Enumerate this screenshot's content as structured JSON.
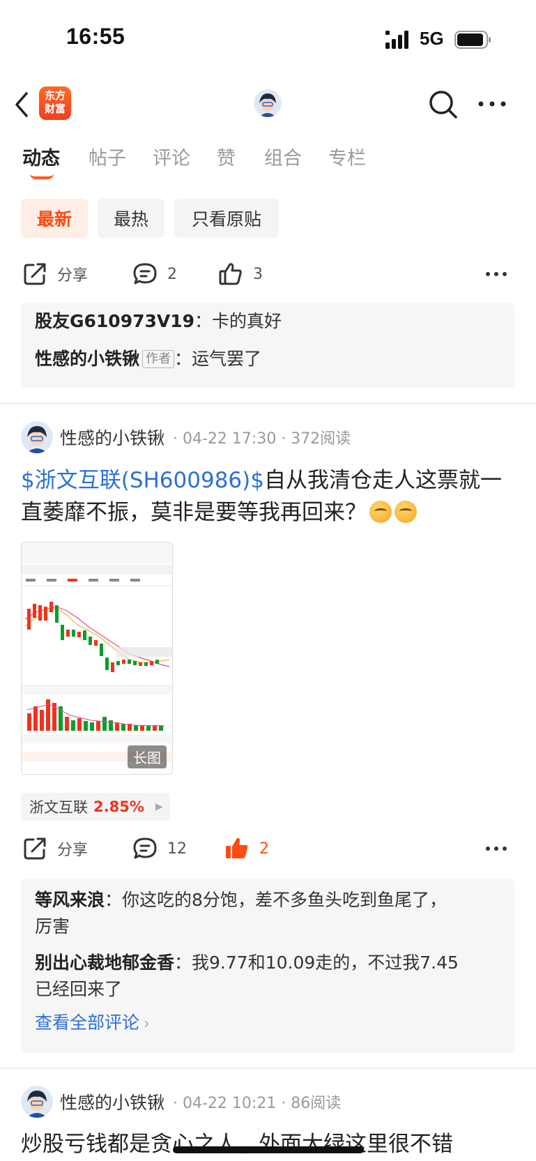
{
  "status_bar": {
    "time": "16:55",
    "network": "5G"
  },
  "nav": {
    "logo_line1": "东方",
    "logo_line2": "财富"
  },
  "tabs": [
    {
      "label": "动态"
    },
    {
      "label": "帖子"
    },
    {
      "label": "评论"
    },
    {
      "label": "赞"
    },
    {
      "label": "组合"
    },
    {
      "label": "专栏"
    }
  ],
  "filters": [
    {
      "label": "最新"
    },
    {
      "label": "最热"
    },
    {
      "label": "只看原贴"
    }
  ],
  "first_actions": {
    "share_label": "分享",
    "comment_count": "2",
    "like_count": "3"
  },
  "first_comments": [
    {
      "author": "股友G610973V19",
      "sep": "：",
      "text": "卡的真好"
    },
    {
      "author": "性感的小铁锹",
      "badge": "作者",
      "sep": "：",
      "text": "运气罢了"
    }
  ],
  "post1": {
    "author": "性感的小铁锹",
    "meta": "· 04-22 17:30 · 372阅读",
    "stock_link": "$浙文互联(SH600986)$",
    "text": "自从我清仓走人这票就一直萎靡不振，莫非是要等我再回来？",
    "image_badge": "长图",
    "stock_tag": {
      "name": "浙文互联",
      "change": "2.85%"
    },
    "actions": {
      "share_label": "分享",
      "comment_count": "12",
      "like_count": "2"
    },
    "comments": [
      {
        "author": "等风来浪",
        "sep": "：",
        "text_line1": "你这吃的8分饱，差不多鱼头吃到鱼尾了，",
        "text_line2": "厉害"
      },
      {
        "author": "别出心裁地郁金香",
        "sep": "：",
        "text_line1": "我9.77和10.09走的，不过我7.45",
        "text_line2": "已经回来了"
      }
    ],
    "view_all": "查看全部评论"
  },
  "post2": {
    "author": "性感的小铁锹",
    "meta": "· 04-22 10:21 · 86阅读",
    "text": "炒股亏钱都是贪心之人，外面大绿这里很不错"
  },
  "colors": {
    "accent": "#ff4b14",
    "link": "#2c6fd8",
    "up": "#f0321d"
  }
}
